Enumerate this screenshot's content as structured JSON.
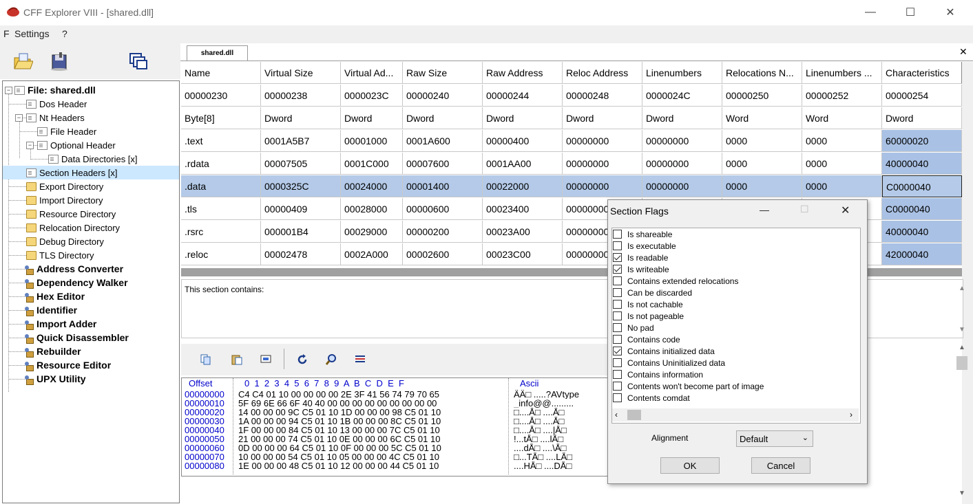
{
  "window": {
    "title": "CFF Explorer VIII - [shared.dll]",
    "minimize": "—",
    "maximize": "☐",
    "close": "✕"
  },
  "menu": {
    "items": [
      "F",
      "Settings",
      "?"
    ]
  },
  "tabs": {
    "active": "shared.dll",
    "close": "✕"
  },
  "tree": {
    "file": "File: shared.dll",
    "items": [
      {
        "label": "Dos Header"
      },
      {
        "label": "Nt Headers"
      },
      {
        "label": "File Header"
      },
      {
        "label": "Optional Header"
      },
      {
        "label": "Data Directories [x]"
      },
      {
        "label": "Section Headers [x]"
      },
      {
        "label": "Export Directory"
      },
      {
        "label": "Import Directory"
      },
      {
        "label": "Resource Directory"
      },
      {
        "label": "Relocation Directory"
      },
      {
        "label": "Debug Directory"
      },
      {
        "label": "TLS Directory"
      }
    ],
    "tools": [
      "Address Converter",
      "Dependency Walker",
      "Hex Editor",
      "Identifier",
      "Import Adder",
      "Quick Disassembler",
      "Rebuilder",
      "Resource Editor",
      "UPX Utility"
    ]
  },
  "grid": {
    "columns": [
      "Name",
      "Virtual Size",
      "Virtual Ad...",
      "Raw Size",
      "Raw Address",
      "Reloc Address",
      "Linenumbers",
      "Relocations N...",
      "Linenumbers ...",
      "Characteristics"
    ],
    "offsets": [
      "00000230",
      "00000238",
      "0000023C",
      "00000240",
      "00000244",
      "00000248",
      "0000024C",
      "00000250",
      "00000252",
      "00000254"
    ],
    "types": [
      "Byte[8]",
      "Dword",
      "Dword",
      "Dword",
      "Dword",
      "Dword",
      "Dword",
      "Word",
      "Word",
      "Dword"
    ],
    "rows": [
      [
        ".text",
        "0001A5B7",
        "00001000",
        "0001A600",
        "00000400",
        "00000000",
        "00000000",
        "0000",
        "0000",
        "60000020"
      ],
      [
        ".rdata",
        "00007505",
        "0001C000",
        "00007600",
        "0001AA00",
        "00000000",
        "00000000",
        "0000",
        "0000",
        "40000040"
      ],
      [
        ".data",
        "0000325C",
        "00024000",
        "00001400",
        "00022000",
        "00000000",
        "00000000",
        "0000",
        "0000",
        "C0000040"
      ],
      [
        ".tls",
        "00000409",
        "00028000",
        "00000600",
        "00023400",
        "00000000",
        "",
        "",
        "",
        "C0000040"
      ],
      [
        ".rsrc",
        "000001B4",
        "00029000",
        "00000200",
        "00023A00",
        "00000000",
        "",
        "",
        "",
        "40000040"
      ],
      [
        ".reloc",
        "00002478",
        "0002A000",
        "00002600",
        "00023C00",
        "00000000",
        "",
        "",
        "",
        "42000040"
      ]
    ]
  },
  "description": {
    "text": "This section contains:"
  },
  "hex": {
    "header_offset": "Offset",
    "header_cols": "0  1  2  3  4  5  6  7  8  9  A  B  C  D  E  F",
    "header_ascii": "Ascii",
    "rows": [
      {
        "off": "00000000",
        "bytes": "C4 C4 01 10 00 00 00 00 2E 3F 41 56 74 79 70 65",
        "ascii": "ÄÄ□ .....?AVtype"
      },
      {
        "off": "00000010",
        "bytes": "5F 69 6E 66 6F 40 40 00 00 00 00 00 00 00 00 00",
        "ascii": "_info@@........."
      },
      {
        "off": "00000020",
        "bytes": "14 00 00 00 9C C5 01 10 1D 00 00 00 98 C5 01 10",
        "ascii": "□....Å□ ....Å□"
      },
      {
        "off": "00000030",
        "bytes": "1A 00 00 00 94 C5 01 10 1B 00 00 00 8C C5 01 10",
        "ascii": "□....Å□ ....Å□"
      },
      {
        "off": "00000040",
        "bytes": "1F 00 00 00 84 C5 01 10 13 00 00 00 7C C5 01 10",
        "ascii": "□....Å□ ....|Å□"
      },
      {
        "off": "00000050",
        "bytes": "21 00 00 00 74 C5 01 10 0E 00 00 00 6C C5 01 10",
        "ascii": "!...tÅ□ ....lÅ□"
      },
      {
        "off": "00000060",
        "bytes": "0D 00 00 00 64 C5 01 10 0F 00 00 00 5C C5 01 10",
        "ascii": "....dÅ□ ....\\Å□"
      },
      {
        "off": "00000070",
        "bytes": "10 00 00 00 54 C5 01 10 05 00 00 00 4C C5 01 10",
        "ascii": "□...TÅ□ ....LÅ□"
      },
      {
        "off": "00000080",
        "bytes": "1E 00 00 00 48 C5 01 10 12 00 00 00 44 C5 01 10",
        "ascii": "....HÅ□ ....DÅ□"
      }
    ]
  },
  "dialog": {
    "title": "Section Flags",
    "flags": [
      {
        "label": "Is shareable",
        "checked": false
      },
      {
        "label": "Is executable",
        "checked": false
      },
      {
        "label": "Is readable",
        "checked": true
      },
      {
        "label": "Is writeable",
        "checked": true
      },
      {
        "label": "Contains extended relocations",
        "checked": false
      },
      {
        "label": "Can be discarded",
        "checked": false
      },
      {
        "label": "Is not cachable",
        "checked": false
      },
      {
        "label": "Is not pageable",
        "checked": false
      },
      {
        "label": "No pad",
        "checked": false
      },
      {
        "label": "Contains code",
        "checked": false
      },
      {
        "label": "Contains initialized data",
        "checked": true
      },
      {
        "label": "Contains Uninitialized data",
        "checked": false
      },
      {
        "label": "Contains information",
        "checked": false
      },
      {
        "label": "Contents won't become part of image",
        "checked": false
      },
      {
        "label": "Contents comdat",
        "checked": false
      }
    ],
    "alignment_label": "Alignment",
    "alignment_value": "Default",
    "ok": "OK",
    "cancel": "Cancel"
  }
}
